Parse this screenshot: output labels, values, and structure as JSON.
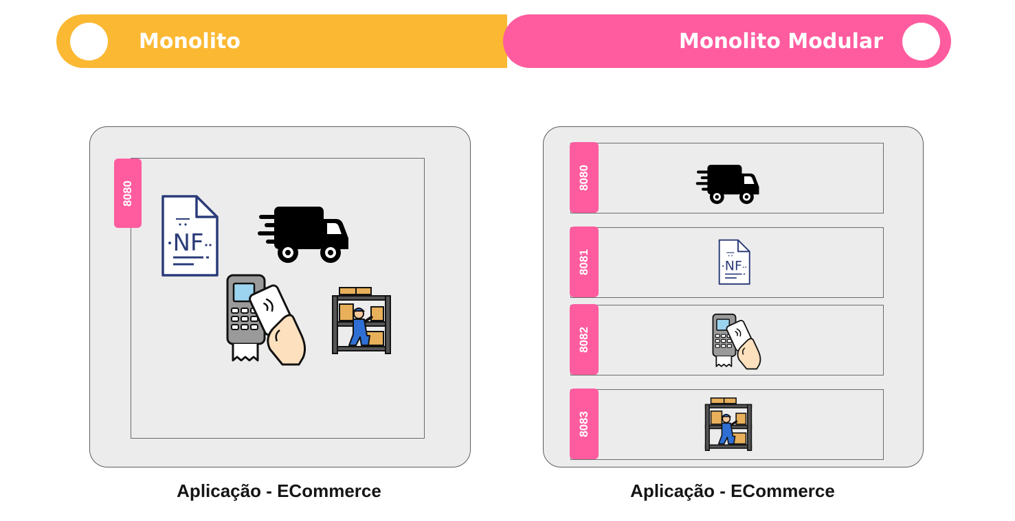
{
  "header": {
    "left_label": "Monolito",
    "right_label": "Monolito Modular"
  },
  "monolith": {
    "port": "8080",
    "caption": "Aplicação - ECommerce",
    "invoice_text": "NF"
  },
  "modular": {
    "caption": "Aplicação - ECommerce",
    "modules": [
      {
        "port": "8080",
        "icon": "delivery-truck-icon"
      },
      {
        "port": "8081",
        "icon": "invoice-nf-icon",
        "invoice_text": "NF"
      },
      {
        "port": "8082",
        "icon": "card-payment-terminal-icon"
      },
      {
        "port": "8083",
        "icon": "warehouse-worker-icon"
      }
    ]
  },
  "colors": {
    "yellow": "#fbb832",
    "pink": "#ff5c9f",
    "panel": "#ececec"
  }
}
